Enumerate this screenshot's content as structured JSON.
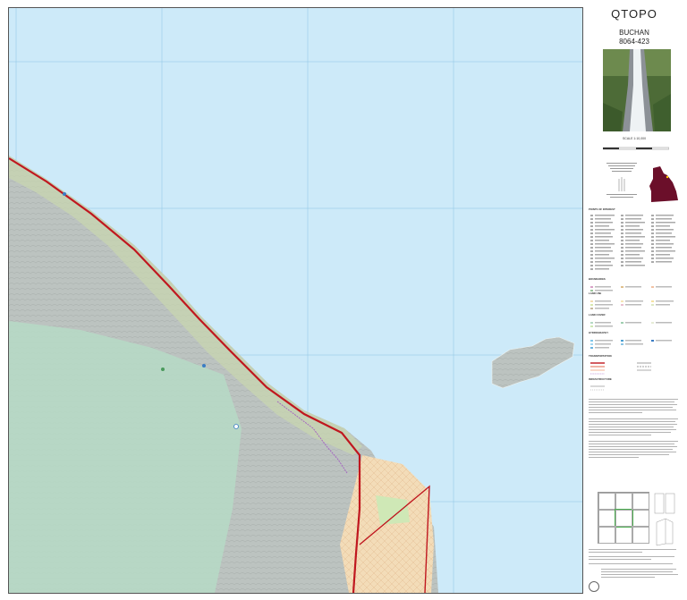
{
  "panel": {
    "brand": "QTOPO",
    "sheet_name": "BUCHAN",
    "sheet_number": "8064-423",
    "scale_label": "SCALE 1:10,000",
    "legend_heading": "POINTS OF INTEREST",
    "legend_sections": [
      "BOUNDARIES",
      "LAND USE",
      "LAND COVER",
      "HYDROGRAPHY",
      "TRANSPORTATION",
      "INFRASTRUCTURE"
    ]
  },
  "colors": {
    "sea": "#cdeaf9",
    "land_relief": "#b9c0bd",
    "road_major": "#c0171f",
    "urban": "#f2d9b1",
    "vegetation": "#b5d9c4",
    "queensland_fill": "#6b0f2a"
  },
  "icons": [
    "waterfall-photo",
    "queensland-locator-map",
    "folding-diagram",
    "government-crest"
  ]
}
